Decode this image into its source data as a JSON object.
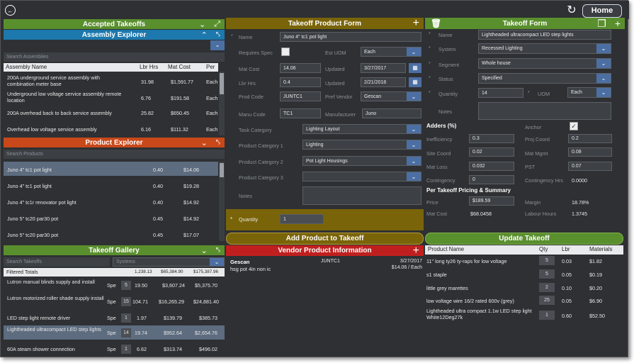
{
  "topbar": {
    "home_label": "Home"
  },
  "accepted": {
    "title": "Accepted Takeoffs"
  },
  "assembly": {
    "title": "Assembly Explorer",
    "search_placeholder": "Search Assemblies",
    "columns": [
      "Assembly Name",
      "Lbr Hrs",
      "Mat Cost",
      "Per"
    ],
    "rows": [
      {
        "name": "200A underground service assembly with combination meter base",
        "lbr": "31.98",
        "mat": "$1,591.77",
        "per": "Each"
      },
      {
        "name": "Underground low voltage service assembly remote location",
        "lbr": "6.76",
        "mat": "$191.58",
        "per": "Each"
      },
      {
        "name": "200A overhead back to back service assembly",
        "lbr": "25.82",
        "mat": "$650.45",
        "per": "Each"
      },
      {
        "name": "Overhead low voltage service assembly",
        "lbr": "6.16",
        "mat": "$111.32",
        "per": "Each"
      }
    ]
  },
  "product": {
    "title": "Product Explorer",
    "search_placeholder": "Search Products",
    "rows": [
      {
        "name": "Juno 4\" tc1 pot light",
        "lbr": "0.40",
        "mat": "$14.06"
      },
      {
        "name": "Juno 4\" tc1 pot light",
        "lbr": "0.40",
        "mat": "$19.28"
      },
      {
        "name": "Juno 4\" tc1r renovator pot light",
        "lbr": "0.40",
        "mat": "$14.92"
      },
      {
        "name": "Juno 5\" tc20 par30 pot",
        "lbr": "0.45",
        "mat": "$14.92"
      },
      {
        "name": "Juno 5\" tc20 par30 pot",
        "lbr": "0.45",
        "mat": "$17.07"
      }
    ]
  },
  "gallery": {
    "title": "Takeoff Gallery",
    "search_placeholder": "Search Takeoffs",
    "systems_placeholder": "Systems",
    "totals": {
      "label": "Filtered Totals",
      "lbr": "1,238.13",
      "mat": "$65,384.90",
      "total": "$175,387.96"
    },
    "rows": [
      {
        "name": "Lutron manual blinds supply and install",
        "unit": "Spe",
        "qty": "5",
        "lbr": "19.50",
        "mat": "$3,607.24",
        "total": "$5,375.70"
      },
      {
        "name": "Lutron motorized roller shade supply install",
        "unit": "Spe",
        "qty": "15",
        "lbr": "104.71",
        "mat": "$16,265.29",
        "total": "$24,881.40"
      },
      {
        "name": "LED step light remote driver",
        "unit": "Spe",
        "qty": "1",
        "lbr": "1.97",
        "mat": "$139.79",
        "total": "$385.73"
      },
      {
        "name": "Lightheaded ultracompact LED step lights",
        "unit": "Spe",
        "qty": "14",
        "lbr": "19.74",
        "mat": "$952.64",
        "total": "$2,654.76"
      },
      {
        "name": "60A steam shower connection",
        "unit": "Spe",
        "qty": "1",
        "lbr": "6.62",
        "mat": "$313.74",
        "total": "$496.02"
      }
    ]
  },
  "productform": {
    "title": "Takeoff Product Form",
    "name_label": "Name",
    "name_value": "Juno 4\" tc1 pot light",
    "reqspec_label": "Requires Spec",
    "estuom_label": "Est UOM",
    "estuom_value": "Each",
    "matcost_label": "Mat Cost",
    "matcost_value": "14.06",
    "updated_label": "Updated",
    "updated1": "3/27/2017",
    "lbrhrs_label": "Lbr Hrs",
    "lbrhrs_value": "0.4",
    "updated2": "2/21/2018",
    "prodcode_label": "Prod Code",
    "prodcode_value": "JUNTC1",
    "prefvendor_label": "Pref Vendor",
    "prefvendor_value": "Gescan",
    "manucode_label": "Manu Code",
    "manucode_value": "TC1",
    "manufacturer_label": "Manufacturer",
    "manufacturer_value": "Juno",
    "taskcat_label": "Task Category",
    "taskcat_value": "Lighting Layout",
    "pc1_label": "Product Category 1",
    "pc1_value": "Lighting",
    "pc2_label": "Product Category 2",
    "pc2_value": "Pot Light Housings",
    "pc3_label": "Product Category 3",
    "pc3_value": "",
    "notes_label": "Notes",
    "quantity_label": "Quantity",
    "quantity_value": "1",
    "add_button": "Add Product to Takeoff"
  },
  "vendor": {
    "title": "Vendor Product Information",
    "vendor": "Gescan",
    "code": "JUNTC1",
    "date": "3/27/2017",
    "desc": "hsg pot 4in non ic",
    "price": "$14.06 / Each"
  },
  "takeoffform": {
    "title": "Takeoff Form",
    "name_label": "Name",
    "name_value": "Lightheaded ultracompact LED step lights",
    "system_label": "System",
    "system_value": "Recessed Lighting",
    "segment_label": "Segment",
    "segment_value": "Whole house",
    "status_label": "Status",
    "status_value": "Specified",
    "quantity_label": "Quantity",
    "quantity_value": "14",
    "uom_label": "UOM",
    "uom_value": "Each",
    "notes_label": "Notes",
    "adders_title": "Adders (%)",
    "anchor_label": "Anchor",
    "inefficiency_label": "Inefficiency",
    "inefficiency_value": "0.3",
    "projcoord_label": "Proj Coord",
    "projcoord_value": "0.2",
    "sitecoord_label": "Site Coord",
    "sitecoord_value": "0.02",
    "matmgmt_label": "Mat Mgmt",
    "matmgmt_value": "0.08",
    "matloss_label": "Mat Loss",
    "matloss_value": "0.032",
    "pst_label": "PST",
    "pst_value": "0.07",
    "contingency_label": "Contingency",
    "contingency_value": "0",
    "contingencyhrs_label": "Contingency Hrs",
    "contingencyhrs_value": "0.0000",
    "summary_title": "Per Takeoff Pricing & Summary",
    "price_label": "Price",
    "price_value": "$189.59",
    "margin_label": "Margin",
    "margin_value": "18.78%",
    "matcost_label": "Mat Cost",
    "matcost_value": "$68.0458",
    "labourhours_label": "Labour Hours",
    "labourhours_value": "1.3745",
    "update_button": "Update Takeoff"
  },
  "products": {
    "columns": [
      "Product Name",
      "Qty",
      "Lbr",
      "Materials"
    ],
    "rows": [
      {
        "name": "11\" long ty26 ty-raps for low voltage",
        "qty": "5",
        "lbr": "0.03",
        "mat": "$1.82"
      },
      {
        "name": "s1 staple",
        "qty": "5",
        "lbr": "0.05",
        "mat": "$0.19"
      },
      {
        "name": "little grey marettes",
        "qty": "2",
        "lbr": "0.10",
        "mat": "$0.20"
      },
      {
        "name": "low voltage wire 16/2 rated 600v (grey)",
        "qty": "25",
        "lbr": "0.05",
        "mat": "$6.90"
      },
      {
        "name": "Lightheaded ultra compact 1.1w LED step light White12Deg27k",
        "qty": "1",
        "lbr": "0.60",
        "mat": "$52.50"
      }
    ]
  }
}
